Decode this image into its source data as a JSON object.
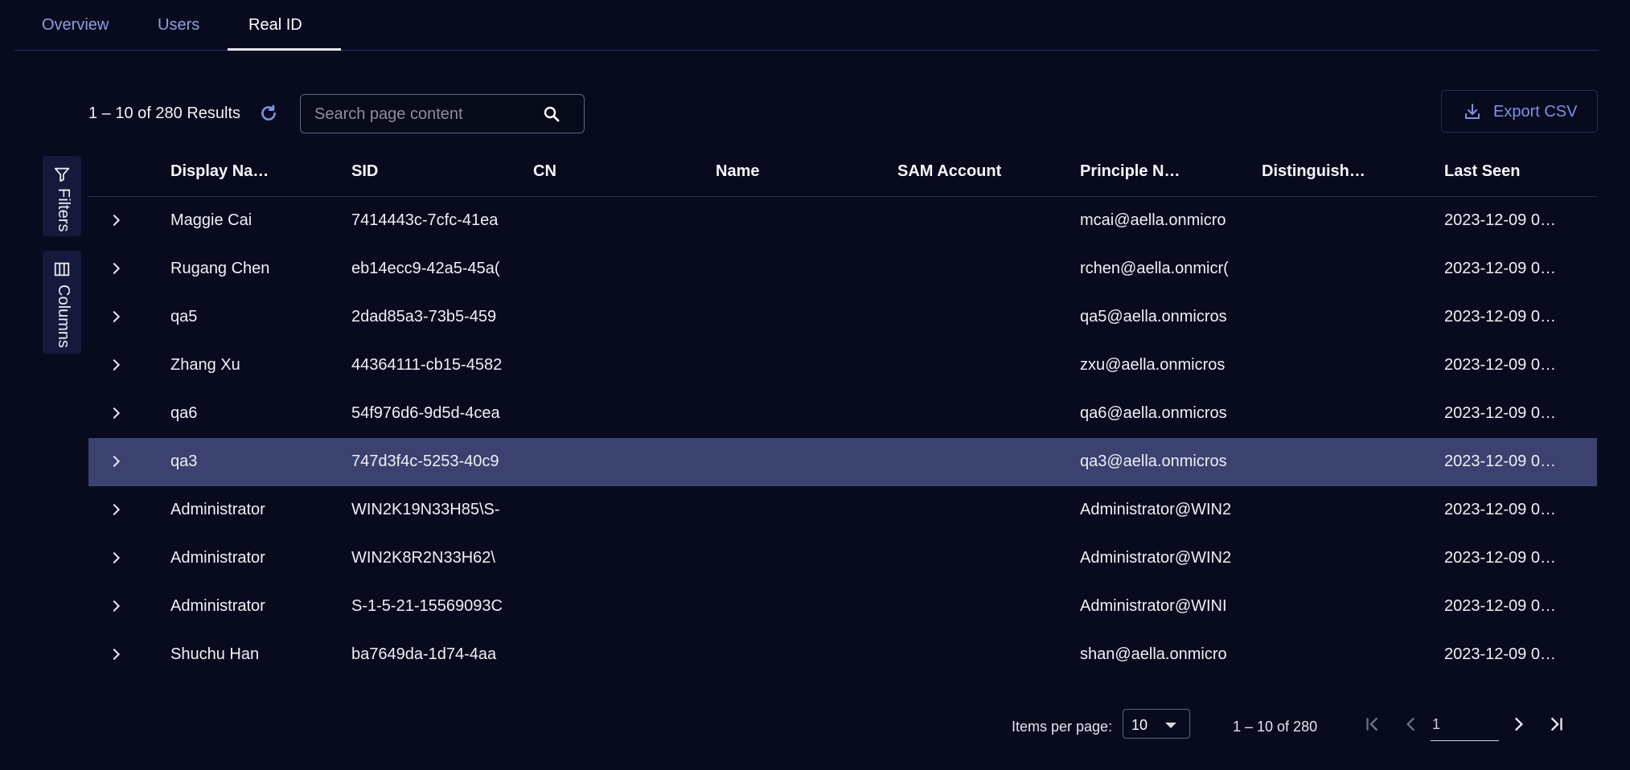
{
  "tabs": [
    {
      "label": "Overview",
      "active": false
    },
    {
      "label": "Users",
      "active": false
    },
    {
      "label": "Real ID",
      "active": true
    }
  ],
  "toolbar": {
    "results_text": "1 – 10 of 280 Results",
    "search_placeholder": "Search page content",
    "search_value": "",
    "export_label": "Export CSV"
  },
  "side": {
    "filters_label": "Filters",
    "columns_label": "Columns"
  },
  "table": {
    "columns": [
      "Display Na…",
      "SID",
      "CN",
      "Name",
      "SAM Account",
      "Principle N…",
      "Distinguish…",
      "Last Seen"
    ],
    "rows": [
      {
        "display": "Maggie Cai",
        "sid": "7414443c-7cfc-41ea",
        "cn": "",
        "name": "",
        "sam": "",
        "principle": "mcai@aella.onmicro",
        "dn": "",
        "last_seen": "2023-12-09 0…"
      },
      {
        "display": "Rugang Chen",
        "sid": "eb14ecc9-42a5-45a(",
        "cn": "",
        "name": "",
        "sam": "",
        "principle": "rchen@aella.onmicr(",
        "dn": "",
        "last_seen": "2023-12-09 0…"
      },
      {
        "display": "qa5",
        "sid": "2dad85a3-73b5-459",
        "cn": "",
        "name": "",
        "sam": "",
        "principle": "qa5@aella.onmicros",
        "dn": "",
        "last_seen": "2023-12-09 0…"
      },
      {
        "display": "Zhang Xu",
        "sid": "44364111-cb15-4582",
        "cn": "",
        "name": "",
        "sam": "",
        "principle": "zxu@aella.onmicros",
        "dn": "",
        "last_seen": "2023-12-09 0…"
      },
      {
        "display": "qa6",
        "sid": "54f976d6-9d5d-4cea",
        "cn": "",
        "name": "",
        "sam": "",
        "principle": "qa6@aella.onmicros",
        "dn": "",
        "last_seen": "2023-12-09 0…"
      },
      {
        "display": "qa3",
        "sid": "747d3f4c-5253-40c9",
        "cn": "",
        "name": "",
        "sam": "",
        "principle": "qa3@aella.onmicros",
        "dn": "",
        "last_seen": "2023-12-09 0…"
      },
      {
        "display": "Administrator",
        "sid": "WIN2K19N33H85\\S-",
        "cn": "",
        "name": "",
        "sam": "",
        "principle": "Administrator@WIN2",
        "dn": "",
        "last_seen": "2023-12-09 0…"
      },
      {
        "display": "Administrator",
        "sid": "WIN2K8R2N33H62\\",
        "cn": "",
        "name": "",
        "sam": "",
        "principle": "Administrator@WIN2",
        "dn": "",
        "last_seen": "2023-12-09 0…"
      },
      {
        "display": "Administrator",
        "sid": "S-1-5-21-15569093C",
        "cn": "",
        "name": "",
        "sam": "",
        "principle": "Administrator@WINI",
        "dn": "",
        "last_seen": "2023-12-09 0…"
      },
      {
        "display": "Shuchu Han",
        "sid": "ba7649da-1d74-4aa",
        "cn": "",
        "name": "",
        "sam": "",
        "principle": "shan@aella.onmicro",
        "dn": "",
        "last_seen": "2023-12-09 0…"
      }
    ],
    "selected_row_index": 5
  },
  "paginator": {
    "items_per_page_label": "Items per page:",
    "items_per_page_value": "10",
    "range_label": "1 – 10 of 280",
    "page_value": "1"
  },
  "icons": {
    "refresh": "refresh-icon",
    "search": "search-icon",
    "export": "download-icon",
    "filters": "filter-icon",
    "columns": "columns-icon",
    "expand": "chevron-right-icon",
    "first": "first-page-icon",
    "prev": "chevron-left-icon",
    "next": "chevron-right-icon",
    "last": "last-page-icon"
  },
  "colors": {
    "background": "#080b1e",
    "accent": "#7f91e6",
    "selected_row": "#3b4270",
    "side_button": "#15193b"
  }
}
